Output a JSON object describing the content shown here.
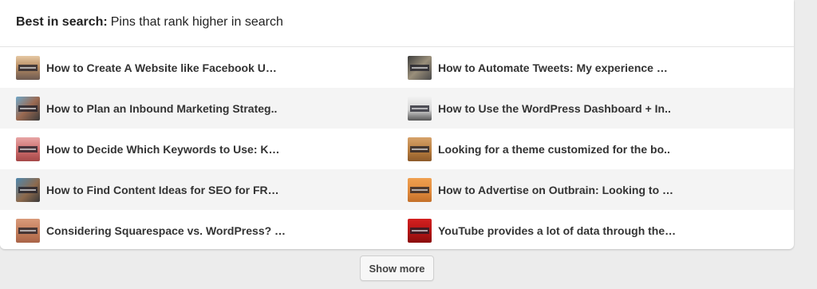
{
  "header": {
    "label": "Best in search:",
    "description": "Pins that rank higher in search"
  },
  "pins": {
    "left": [
      {
        "title": "How to Create A Website like Facebook U…",
        "thumb": "website-screenshot-thumbnail"
      },
      {
        "title": "How to Plan an Inbound Marketing Strateg..",
        "thumb": "desk-photo-thumbnail"
      },
      {
        "title": "How to Decide Which Keywords to Use: K…",
        "thumb": "pink-graphic-thumbnail"
      },
      {
        "title": "How to Find Content Ideas for SEO for FR…",
        "thumb": "desk-photo-thumbnail"
      },
      {
        "title": "Considering Squarespace vs. WordPress? …",
        "thumb": "brick-graphic-thumbnail"
      }
    ],
    "right": [
      {
        "title": "How to Automate Tweets: My experience …",
        "thumb": "dark-graphic-thumbnail"
      },
      {
        "title": "How to Use the WordPress Dashboard + In..",
        "thumb": "dashboard-screenshot-thumbnail"
      },
      {
        "title": "Looking for a theme customized for the bo..",
        "thumb": "orange-graphic-thumbnail"
      },
      {
        "title": "How to Advertise on Outbrain: Looking to …",
        "thumb": "orange-graphic-thumbnail"
      },
      {
        "title": "YouTube provides a lot of data through the…",
        "thumb": "red-graphic-thumbnail"
      }
    ]
  },
  "show_more": {
    "label": "Show more"
  },
  "colors": {
    "background": "#ececec",
    "card": "#ffffff",
    "alt_row": "#f4f4f4",
    "text": "#333333"
  }
}
